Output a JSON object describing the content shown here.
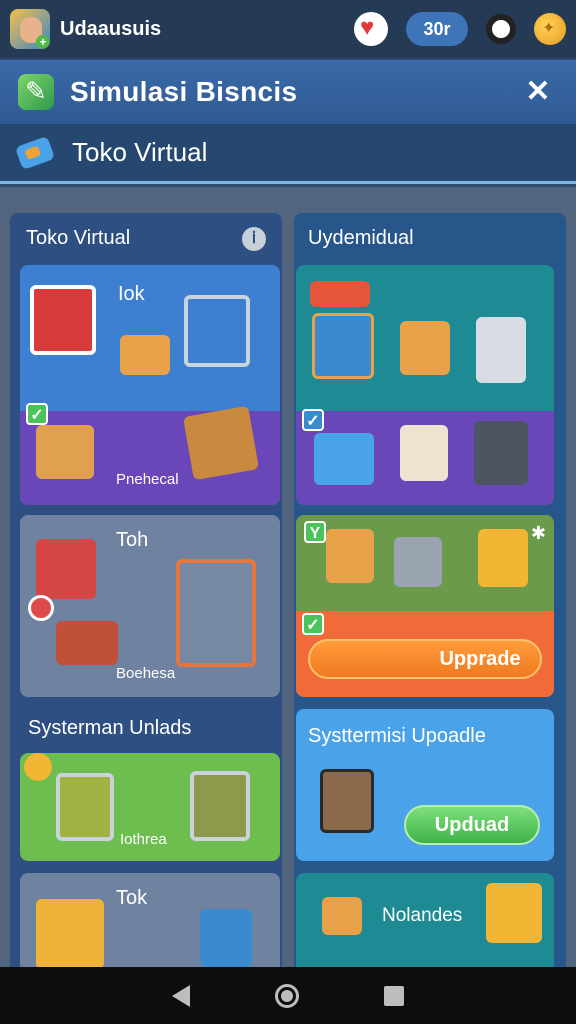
{
  "topbar": {
    "username": "Udaausuis",
    "coins": "30r",
    "icons": [
      "avatar",
      "heart-icon",
      "pro-badge-icon",
      "coin-icon"
    ]
  },
  "header": {
    "title": "Simulasi Bisncis",
    "close_label": "✕"
  },
  "subheader": {
    "title": "Toko Virtual"
  },
  "left_column": {
    "title": "Toko Virtual",
    "info_label": "ⅰ",
    "card1": {
      "title": "Iok",
      "label": "Pnehecal"
    },
    "card2": {
      "title": "Toh",
      "label": "Boehesa"
    },
    "section_title": "Systerman Unlads",
    "card3": {
      "label": "Iothrea"
    },
    "card4": {
      "title": "Tok",
      "label": ""
    }
  },
  "right_column": {
    "title": "Uydemidual",
    "card1": {},
    "card2": {
      "upgrade_label": "Upprade",
      "corner_label": "Y"
    },
    "card3": {
      "title": "Systtermisi Upoadle",
      "button_label": "Upduad"
    },
    "card4": {
      "title": "Nolandes"
    }
  },
  "colors": {
    "accent_orange": "#f07a20",
    "accent_green": "#3eb34a",
    "purple": "#6a47b8",
    "teal": "#1e8a94",
    "panel_blue": "#2d4f82"
  }
}
